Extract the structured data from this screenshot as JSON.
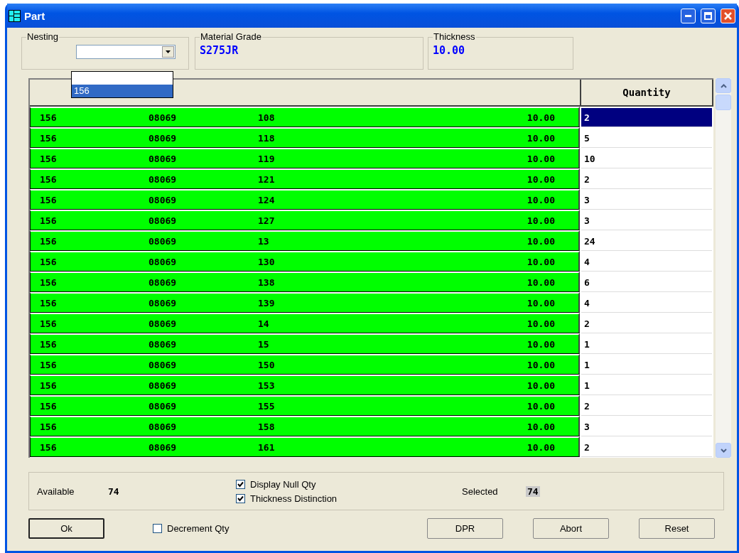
{
  "window": {
    "title": "Part"
  },
  "nesting": {
    "label": "Nesting",
    "options": [
      {
        "label": "156",
        "selected": true
      }
    ],
    "expanded": true
  },
  "material_grade": {
    "label": "Material Grade",
    "value": "S275JR"
  },
  "thickness": {
    "label": "Thickness",
    "value": "10.00"
  },
  "table": {
    "columns": [
      "",
      "",
      "",
      "",
      "Quantity"
    ],
    "rows": [
      {
        "cells": [
          "156",
          "08069",
          "108",
          "10.00",
          "2"
        ],
        "selected": true
      },
      {
        "cells": [
          "156",
          "08069",
          "118",
          "10.00",
          "5"
        ],
        "selected": false
      },
      {
        "cells": [
          "156",
          "08069",
          "119",
          "10.00",
          "10"
        ],
        "selected": false
      },
      {
        "cells": [
          "156",
          "08069",
          "121",
          "10.00",
          "2"
        ],
        "selected": false
      },
      {
        "cells": [
          "156",
          "08069",
          "124",
          "10.00",
          "3"
        ],
        "selected": false
      },
      {
        "cells": [
          "156",
          "08069",
          "127",
          "10.00",
          "3"
        ],
        "selected": false
      },
      {
        "cells": [
          "156",
          "08069",
          "13",
          "10.00",
          "24"
        ],
        "selected": false
      },
      {
        "cells": [
          "156",
          "08069",
          "130",
          "10.00",
          "4"
        ],
        "selected": false
      },
      {
        "cells": [
          "156",
          "08069",
          "138",
          "10.00",
          "6"
        ],
        "selected": false
      },
      {
        "cells": [
          "156",
          "08069",
          "139",
          "10.00",
          "4"
        ],
        "selected": false
      },
      {
        "cells": [
          "156",
          "08069",
          "14",
          "10.00",
          "2"
        ],
        "selected": false
      },
      {
        "cells": [
          "156",
          "08069",
          "15",
          "10.00",
          "1"
        ],
        "selected": false
      },
      {
        "cells": [
          "156",
          "08069",
          "150",
          "10.00",
          "1"
        ],
        "selected": false
      },
      {
        "cells": [
          "156",
          "08069",
          "153",
          "10.00",
          "1"
        ],
        "selected": false
      },
      {
        "cells": [
          "156",
          "08069",
          "155",
          "10.00",
          "2"
        ],
        "selected": false
      },
      {
        "cells": [
          "156",
          "08069",
          "158",
          "10.00",
          "3"
        ],
        "selected": false
      },
      {
        "cells": [
          "156",
          "08069",
          "161",
          "10.00",
          "2"
        ],
        "selected": false
      }
    ]
  },
  "summary": {
    "available_label": "Available",
    "available": "74",
    "selected_label": "Selected",
    "selected": "74",
    "checkboxes": [
      {
        "label": "Display Null Qty",
        "checked": true
      },
      {
        "label": "Thickness Distinction",
        "checked": true
      }
    ]
  },
  "decrement": {
    "label": "Decrement Qty",
    "checked": false
  },
  "buttons": [
    {
      "label": "Ok",
      "default": true
    },
    {
      "label": "DPR",
      "default": false
    },
    {
      "label": "Abort",
      "default": false
    },
    {
      "label": "Reset",
      "default": false
    }
  ]
}
